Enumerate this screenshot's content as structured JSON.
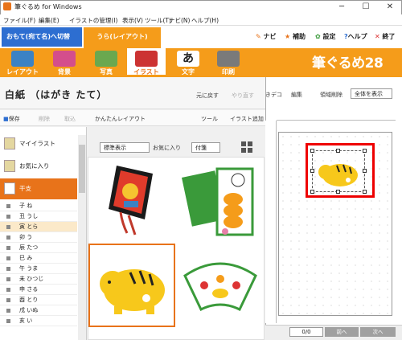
{
  "window": {
    "title": "筆ぐるめ for Windows",
    "minimize": "─",
    "maximize": "☐",
    "close": "✕"
  },
  "menu": [
    "ファイル(F)",
    "編集(E)",
    "イラストの管理(I)",
    "表示(V)",
    "ツール(T)",
    "ナビ(N)",
    "ヘルプ(H)"
  ],
  "tabs": {
    "omote": "おもて(宛て名)へ切替",
    "ura": "うら(レイアウト)"
  },
  "top_actions": {
    "navi": "ナビ",
    "hojo": "補助",
    "settei": "設定",
    "help": "ヘルプ",
    "exit": "終了"
  },
  "ribbon": [
    {
      "label": "レイアウト",
      "color": "#3b82c4"
    },
    {
      "label": "背景",
      "color": "#d44e8c"
    },
    {
      "label": "写真",
      "color": "#6aa84f"
    },
    {
      "label": "イラスト",
      "color": "#cc3333"
    },
    {
      "label": "文字",
      "color": "#222222"
    },
    {
      "label": "印刷",
      "color": "#7a7a7a"
    }
  ],
  "logo": "筆ぐるめ28",
  "doc": {
    "title": "白紙 （はがき たて）",
    "undo": "元に戻す",
    "redo": "やり直す"
  },
  "toolbar": {
    "save": "保存",
    "delete": "削除",
    "import": "取込",
    "easy_layout": "かんたんレイアウト",
    "tools": "ツール",
    "add_illust": "イラスト追加"
  },
  "categories": {
    "my": "マイイラスト",
    "fav": "お気に入り",
    "eto": "干支"
  },
  "eto_items": [
    "子 ね",
    "丑 うし",
    "寅 とら",
    "卯 う",
    "辰 たつ",
    "巳 み",
    "午 うま",
    "未 ひつじ",
    "申 さる",
    "酉 とり",
    "戌 いぬ",
    "亥 い"
  ],
  "grid_controls": {
    "display": "標準表示",
    "fav": "お気に入り",
    "attach": "付箋"
  },
  "canvas_toolbar": {
    "ideco": "きデコ",
    "edit": "編集",
    "clear": "領域削除",
    "zoom": "全体を表示"
  },
  "status": {
    "page": "0/0",
    "prev": "前へ",
    "next": "次へ"
  }
}
